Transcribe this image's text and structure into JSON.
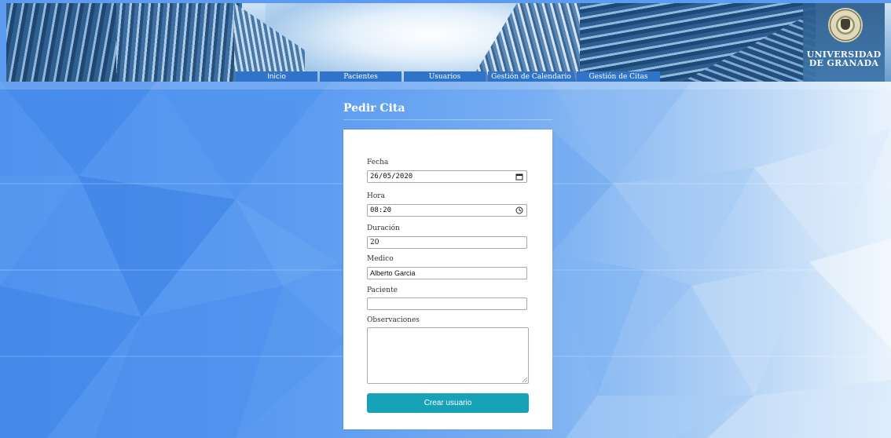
{
  "header": {
    "logo_line1": "UNIVERSIDAD",
    "logo_line2": "DE GRANADA"
  },
  "nav": {
    "items": [
      "Inicio",
      "Pacientes",
      "Usuarios",
      "Gestión de Calendario",
      "Gestión de Citas"
    ]
  },
  "page": {
    "title": "Pedir Cita"
  },
  "form": {
    "fecha_label": "Fecha",
    "fecha_value": "26/05/2020",
    "hora_label": "Hora",
    "hora_value": "08:20",
    "duracion_label": "Duración",
    "duracion_value": "20",
    "medico_label": "Medico",
    "medico_value": "Alberto Garcia",
    "paciente_label": "Paciente",
    "paciente_value": "",
    "observaciones_label": "Observaciones",
    "observaciones_value": "",
    "submit_label": "Crear usuario"
  },
  "icons": {
    "date": "calendar-icon",
    "time": "clock-icon",
    "seal": "university-seal"
  },
  "colors": {
    "nav_bg": "#2f74c8",
    "button_bg": "#17a2b8",
    "background": "#5d9bf0"
  }
}
